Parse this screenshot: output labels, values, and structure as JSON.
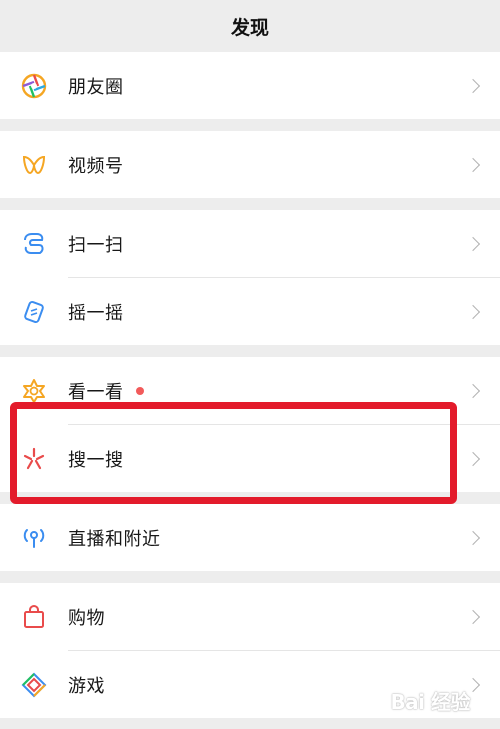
{
  "header": {
    "title": "发现"
  },
  "groups": [
    {
      "items": [
        {
          "label": "朋友圈",
          "icon": "moments-icon"
        }
      ]
    },
    {
      "items": [
        {
          "label": "视频号",
          "icon": "channels-icon"
        }
      ]
    },
    {
      "items": [
        {
          "label": "扫一扫",
          "icon": "scan-icon"
        },
        {
          "label": "摇一摇",
          "icon": "shake-icon"
        }
      ]
    },
    {
      "items": [
        {
          "label": "看一看",
          "icon": "top-stories-icon",
          "badge": "red-dot"
        },
        {
          "label": "搜一搜",
          "icon": "search-icon"
        }
      ]
    },
    {
      "items": [
        {
          "label": "直播和附近",
          "icon": "live-nearby-icon"
        }
      ]
    },
    {
      "items": [
        {
          "label": "购物",
          "icon": "shopping-icon"
        },
        {
          "label": "游戏",
          "icon": "games-icon"
        }
      ]
    }
  ],
  "highlight": {
    "target": "搜一搜",
    "color": "#e31b2b"
  },
  "watermark": {
    "text": "Bai 经验"
  },
  "colors": {
    "background": "#ededed",
    "row_background": "#ffffff",
    "badge": "#f25a5a",
    "chevron": "#b2b2b2"
  }
}
